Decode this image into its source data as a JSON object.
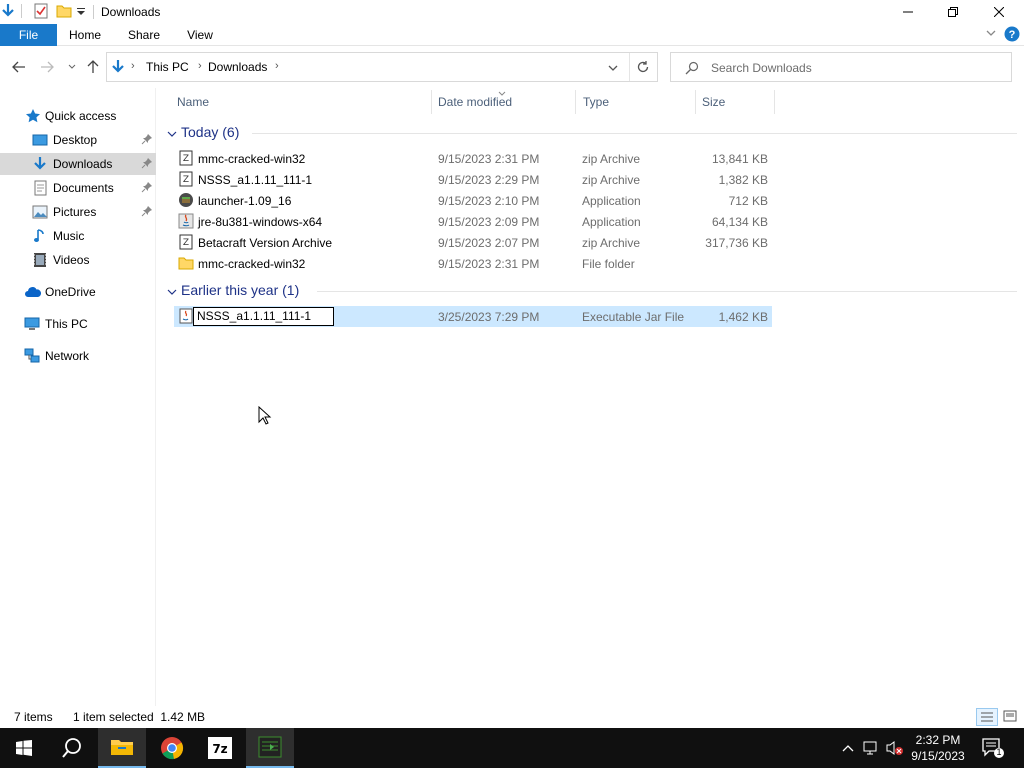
{
  "window": {
    "title": "Downloads"
  },
  "ribbon": {
    "tabs": [
      "File",
      "Home",
      "Share",
      "View"
    ]
  },
  "address": {
    "breadcrumbs": [
      "This PC",
      "Downloads"
    ],
    "search_placeholder": "Search Downloads"
  },
  "sidebar": {
    "items": [
      {
        "label": "Quick access",
        "icon": "star-icon"
      },
      {
        "label": "Desktop",
        "icon": "desktop-icon",
        "pinned": true
      },
      {
        "label": "Downloads",
        "icon": "download-arrow-icon",
        "pinned": true,
        "selected": true
      },
      {
        "label": "Documents",
        "icon": "documents-icon",
        "pinned": true
      },
      {
        "label": "Pictures",
        "icon": "pictures-icon",
        "pinned": true
      },
      {
        "label": "Music",
        "icon": "music-icon"
      },
      {
        "label": "Videos",
        "icon": "videos-icon"
      },
      {
        "label": "OneDrive",
        "icon": "cloud-icon"
      },
      {
        "label": "This PC",
        "icon": "computer-icon"
      },
      {
        "label": "Network",
        "icon": "network-icon"
      }
    ]
  },
  "columns": [
    "Name",
    "Date modified",
    "Type",
    "Size"
  ],
  "groups": [
    {
      "label": "Today (6)",
      "files": [
        {
          "name": "mmc-cracked-win32",
          "date": "9/15/2023 2:31 PM",
          "type": "zip Archive",
          "size": "13,841 KB",
          "icon": "zip-icon"
        },
        {
          "name": "NSSS_a1.1.11_111-1",
          "date": "9/15/2023 2:29 PM",
          "type": "zip Archive",
          "size": "1,382 KB",
          "icon": "zip-icon"
        },
        {
          "name": "launcher-1.09_16",
          "date": "9/15/2023 2:10 PM",
          "type": "Application",
          "size": "712 KB",
          "icon": "launcher-icon"
        },
        {
          "name": "jre-8u381-windows-x64",
          "date": "9/15/2023 2:09 PM",
          "type": "Application",
          "size": "64,134 KB",
          "icon": "java-installer-icon"
        },
        {
          "name": "Betacraft Version Archive",
          "date": "9/15/2023 2:07 PM",
          "type": "zip Archive",
          "size": "317,736 KB",
          "icon": "zip-icon"
        },
        {
          "name": "mmc-cracked-win32",
          "date": "9/15/2023 2:31 PM",
          "type": "File folder",
          "size": "",
          "icon": "folder-icon"
        }
      ]
    },
    {
      "label": "Earlier this year (1)",
      "files": [
        {
          "name": "NSSS_a1.1.11_111-1",
          "date": "3/25/2023 7:29 PM",
          "type": "Executable Jar File",
          "size": "1,462 KB",
          "icon": "jar-icon",
          "renaming": true
        }
      ]
    }
  ],
  "status": {
    "items": "7 items",
    "selection": "1 item selected  1.42 MB"
  },
  "taskbar": {
    "apps": [
      "start-icon",
      "search-icon",
      "file-explorer-icon",
      "chrome-icon",
      "7zip-icon",
      "terminal-icon"
    ],
    "time": "2:32 PM",
    "date": "9/15/2023",
    "notification_count": "1"
  },
  "colors": {
    "accent": "#1979ca",
    "selection": "#cce8ff",
    "group_header": "#1e3287",
    "taskbar": "#101010"
  }
}
